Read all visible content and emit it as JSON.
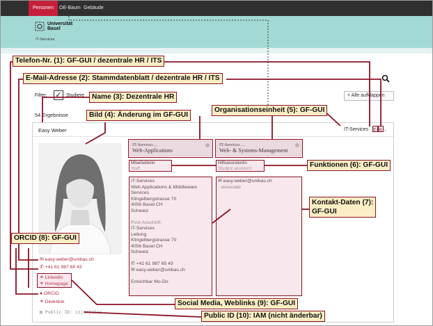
{
  "nav": {
    "items": [
      "Personen",
      "OE-Baum",
      "Gebäude"
    ]
  },
  "logo": {
    "line1": "Universität",
    "line2": "Basel",
    "subunit": "IT-Services"
  },
  "filter": {
    "label": "Filter:",
    "checkbox_text": "Studiere",
    "collapse_label": "+ Alle aufklappen"
  },
  "results": {
    "count_text": "54 Ergebnisse"
  },
  "card": {
    "name": "Easy Weber",
    "unit": "IT-Services",
    "org_units": [
      {
        "l1": "IT-Services ...",
        "l2": "Web-Applications"
      },
      {
        "l1": "IT-Services ...",
        "l2": "Web- & Systems-Management"
      }
    ],
    "functions": [
      {
        "title": "Mitarbeiterin",
        "sub": "Staff"
      },
      {
        "title": "Hilfsassistentin",
        "sub": "Student assistent"
      }
    ],
    "contact_left": [
      "IT-Services",
      "Web Applications & Middleware",
      "Services",
      "Klingelbergstrasse 70",
      "4056 Basel CH",
      "Schweiz",
      "",
      "Post-Anschrift:",
      "IT-Services",
      "Leitung",
      "Klingelbergstrasse 70",
      "4056 Basel CH",
      "Schweiz",
      "",
      "+41 61 987 65 43",
      "easy.weber@unibas.ch",
      "",
      "Erreichbar Mo-Do"
    ],
    "contact_right": [
      "easy.weber@unibas.ch",
      "associate"
    ],
    "email": "easy.weber@unibas.ch",
    "phone": "+41 61 987 65 43",
    "social": [
      "LinkedIn",
      "Homepage"
    ],
    "orcid": "ORCID",
    "direktlink": "Direktlink",
    "public_id": "Public ID: izjmnjclos"
  },
  "annotations": {
    "telefon": "Telefon-Nr. (1): GF-GUI / dezentrale HR / ITS",
    "email": "E-Mail-Adresse (2): Stammdatenblatt / dezentrale HR / ITS",
    "name": "Name (3): Dezentrale HR",
    "bild": "Bild (4): Änderung im GF-GUI",
    "oe": "Organisationseinheit (5): GF-GUI",
    "funktionen": "Funktionen (6): GF-GUI",
    "kontakt_l1": "Kontakt-Daten (7):",
    "kontakt_l2": "GF-GUI",
    "orcid": "ORCID (8): GF-GUI",
    "social": "Social Media, Weblinks (9): GF-GUI",
    "publicid": "Public ID (10): IAM (nicht änderbar)"
  },
  "colors": {
    "accent": "#c4203c",
    "band": "#a3d9d5",
    "annotation_border": "#8b1124",
    "callout_bg": "#fbeec4"
  }
}
